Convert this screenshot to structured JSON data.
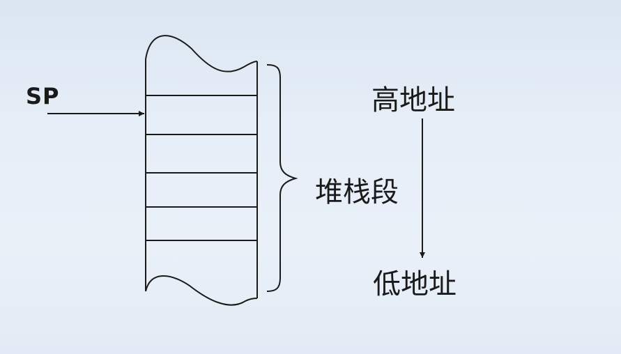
{
  "labels": {
    "stack_pointer": "SP",
    "stack_segment": "堆栈段",
    "high_address": "高地址",
    "low_address": "低地址"
  },
  "colors": {
    "ink": "#1a1a1a",
    "background": "#e6eef7"
  }
}
